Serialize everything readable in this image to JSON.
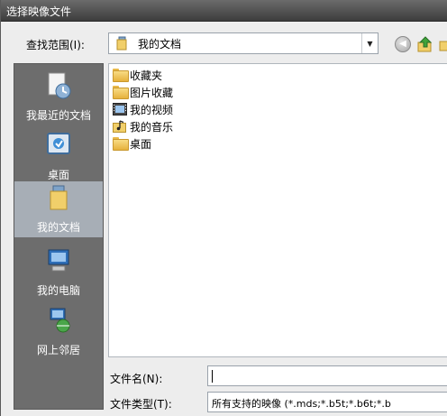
{
  "window": {
    "title": "选择映像文件"
  },
  "lookin": {
    "label": "查找范围(I):",
    "value": "我的文档"
  },
  "places": [
    {
      "label": "我最近的文档",
      "icon": "recent-documents-icon"
    },
    {
      "label": "桌面",
      "icon": "desktop-icon"
    },
    {
      "label": "我的文档",
      "icon": "my-documents-icon"
    },
    {
      "label": "我的电脑",
      "icon": "my-computer-icon"
    },
    {
      "label": "网上邻居",
      "icon": "network-places-icon"
    }
  ],
  "files": [
    {
      "name": "收藏夹",
      "icon": "folder-icon"
    },
    {
      "name": "图片收藏",
      "icon": "folder-icon"
    },
    {
      "name": "我的视频",
      "icon": "video-folder-icon"
    },
    {
      "name": "我的音乐",
      "icon": "music-folder-icon"
    },
    {
      "name": "桌面",
      "icon": "folder-icon"
    }
  ],
  "filename": {
    "label": "文件名(N):",
    "value": ""
  },
  "filetype": {
    "label": "文件类型(T):",
    "value": "所有支持的映像 (*.mds;*.b5t;*.b6t;*.b"
  },
  "colors": {
    "selected_place": "#a7aeb6",
    "sidebar": "#6d6d6d",
    "titlebar": "#4a4a4a"
  }
}
